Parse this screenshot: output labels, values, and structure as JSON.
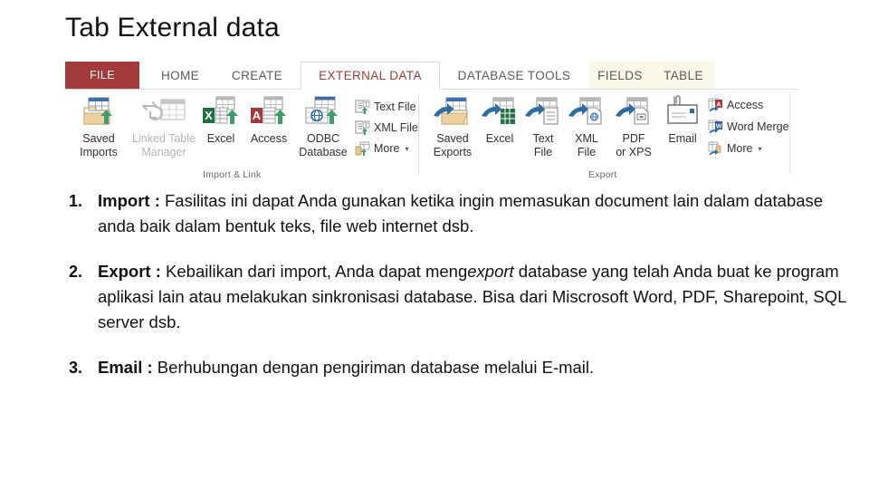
{
  "slide": {
    "title": "Tab External data"
  },
  "ribbon": {
    "tabs": [
      {
        "id": "file",
        "label": "FILE"
      },
      {
        "id": "home",
        "label": "HOME"
      },
      {
        "id": "create",
        "label": "CREATE"
      },
      {
        "id": "external",
        "label": "EXTERNAL DATA"
      },
      {
        "id": "dbtools",
        "label": "DATABASE TOOLS"
      },
      {
        "id": "fields",
        "label": "FIELDS"
      },
      {
        "id": "table",
        "label": "TABLE"
      }
    ],
    "active_tab": "EXTERNAL DATA",
    "groups": [
      {
        "id": "import-link",
        "label": "Import & Link"
      },
      {
        "id": "export",
        "label": "Export"
      }
    ],
    "import_group": {
      "big_buttons": [
        {
          "id": "saved-imports",
          "line1": "Saved",
          "line2": "Imports",
          "icon": "saved-imports-icon",
          "disabled": false
        },
        {
          "id": "linked-table-manager",
          "line1": "Linked Table",
          "line2": "Manager",
          "icon": "linked-table-manager-icon",
          "disabled": true
        },
        {
          "id": "excel-import",
          "line1": "Excel",
          "line2": "",
          "icon": "excel-import-icon",
          "disabled": false
        },
        {
          "id": "access-import",
          "line1": "Access",
          "line2": "",
          "icon": "access-import-icon",
          "disabled": false
        },
        {
          "id": "odbc-database",
          "line1": "ODBC",
          "line2": "Database",
          "icon": "odbc-database-icon",
          "disabled": false
        }
      ],
      "small_buttons": [
        {
          "id": "text-file-import",
          "label": "Text File",
          "icon": "text-file-import-icon",
          "caret": false
        },
        {
          "id": "xml-file-import",
          "label": "XML File",
          "icon": "xml-file-import-icon",
          "caret": false
        },
        {
          "id": "more-import",
          "label": "More",
          "icon": "more-import-icon",
          "caret": true
        }
      ]
    },
    "export_group": {
      "big_buttons": [
        {
          "id": "saved-exports",
          "line1": "Saved",
          "line2": "Exports",
          "icon": "saved-exports-icon"
        },
        {
          "id": "excel-export",
          "line1": "Excel",
          "line2": "",
          "icon": "excel-export-icon"
        },
        {
          "id": "text-file-export",
          "line1": "Text",
          "line2": "File",
          "icon": "text-file-export-icon"
        },
        {
          "id": "xml-file-export",
          "line1": "XML",
          "line2": "File",
          "icon": "xml-file-export-icon"
        },
        {
          "id": "pdf-or-xps",
          "line1": "PDF",
          "line2": "or XPS",
          "icon": "pdf-or-xps-icon"
        },
        {
          "id": "email",
          "line1": "Email",
          "line2": "",
          "icon": "email-icon"
        }
      ],
      "small_buttons": [
        {
          "id": "access-export",
          "label": "Access",
          "icon": "access-export-icon",
          "caret": false
        },
        {
          "id": "word-merge",
          "label": "Word Merge",
          "icon": "word-merge-icon",
          "caret": false
        },
        {
          "id": "more-export",
          "label": "More",
          "icon": "more-export-icon",
          "caret": true
        }
      ]
    }
  },
  "content": {
    "items": [
      {
        "number": "1.",
        "term": "Import :",
        "body_a": " Fasilitas ini dapat Anda gunakan ketika ingin memasukan document lain dalam database anda baik dalam bentuk teks, file web internet dsb.",
        "italic": "",
        "body_b": ""
      },
      {
        "number": "2.",
        "term": "Export :",
        "body_a": " Kebailikan dari import, Anda dapat meng",
        "italic": "export",
        "body_b": " database yang telah Anda buat ke program aplikasi lain atau melakukan sinkronisasi database. Bisa dari Miscrosoft Word, PDF, Sharepoint, SQL server dsb."
      },
      {
        "number": "3.",
        "term": "Email :",
        "body_a": " Berhubungan dengan pengiriman database melalui E-mail.",
        "italic": "",
        "body_b": ""
      }
    ]
  },
  "colors": {
    "file_tab": "#a33b3b",
    "active_tab_text": "#a33b3b",
    "contextual_tab": "#fbf7e6",
    "excel_green": "#1e7145",
    "access_red": "#a4373a",
    "word_blue": "#2b5797",
    "arrow_green": "#3f9c6d",
    "arrow_blue": "#2e6da4",
    "text": "#111111"
  }
}
